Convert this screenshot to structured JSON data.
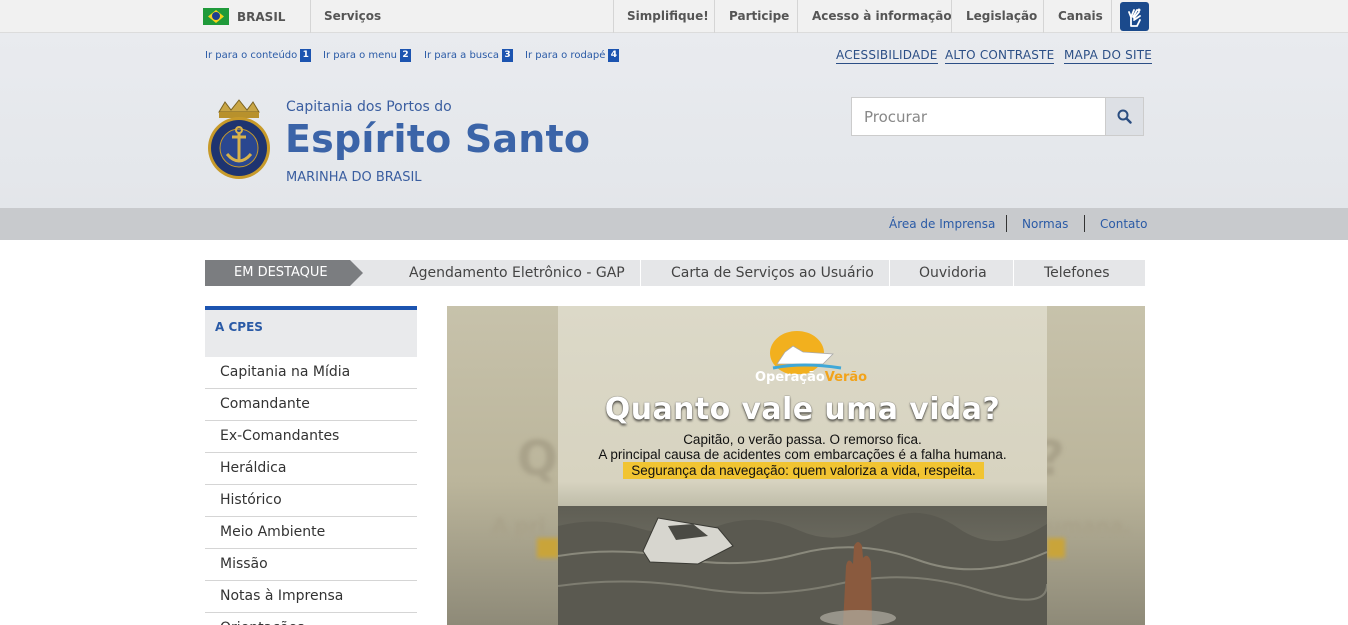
{
  "govbar": {
    "brasil": "BRASIL",
    "servicos": "Serviços",
    "links": [
      "Simplifique!",
      "Participe",
      "Acesso à informação",
      "Legislação",
      "Canais"
    ]
  },
  "skip_links": [
    {
      "label": "Ir para o conteúdo",
      "num": "1"
    },
    {
      "label": "Ir para o menu",
      "num": "2"
    },
    {
      "label": "Ir para a busca",
      "num": "3"
    },
    {
      "label": "Ir para o rodapé",
      "num": "4"
    }
  ],
  "top_right_links": [
    "ACESSIBILIDADE",
    "ALTO CONTRASTE",
    "MAPA DO SITE"
  ],
  "header": {
    "subtitle": "Capitania dos Portos do",
    "title": "Espírito Santo",
    "org": "MARINHA DO BRASIL"
  },
  "search": {
    "placeholder": "Procurar"
  },
  "graybar_links": [
    "Área de Imprensa",
    "Normas",
    "Contato"
  ],
  "destaque": {
    "label": "EM DESTAQUE",
    "items": [
      "Agendamento Eletrônico - GAP",
      "Carta de Serviços ao Usuário",
      "Ouvidoria",
      "Telefones"
    ]
  },
  "sidebar": {
    "header": "A CPES",
    "items": [
      "Capitania na Mídia",
      "Comandante",
      "Ex-Comandantes",
      "Heráldica",
      "Histórico",
      "Meio Ambiente",
      "Missão",
      "Notas à Imprensa",
      "Orientações"
    ]
  },
  "banner": {
    "brand_a": "Operação",
    "brand_b": "Verão",
    "headline": "Quanto vale uma vida?",
    "line1": "Capitão, o verão passa. O remorso fica.",
    "line2": "A principal causa de acidentes com embarcações é a falha humana.",
    "highlight": "Segurança da navegação: quem valoriza a vida, respeita."
  },
  "colors": {
    "accent": "#1c54b0",
    "link": "#2a5aa6",
    "highlight": "#f1c432"
  }
}
